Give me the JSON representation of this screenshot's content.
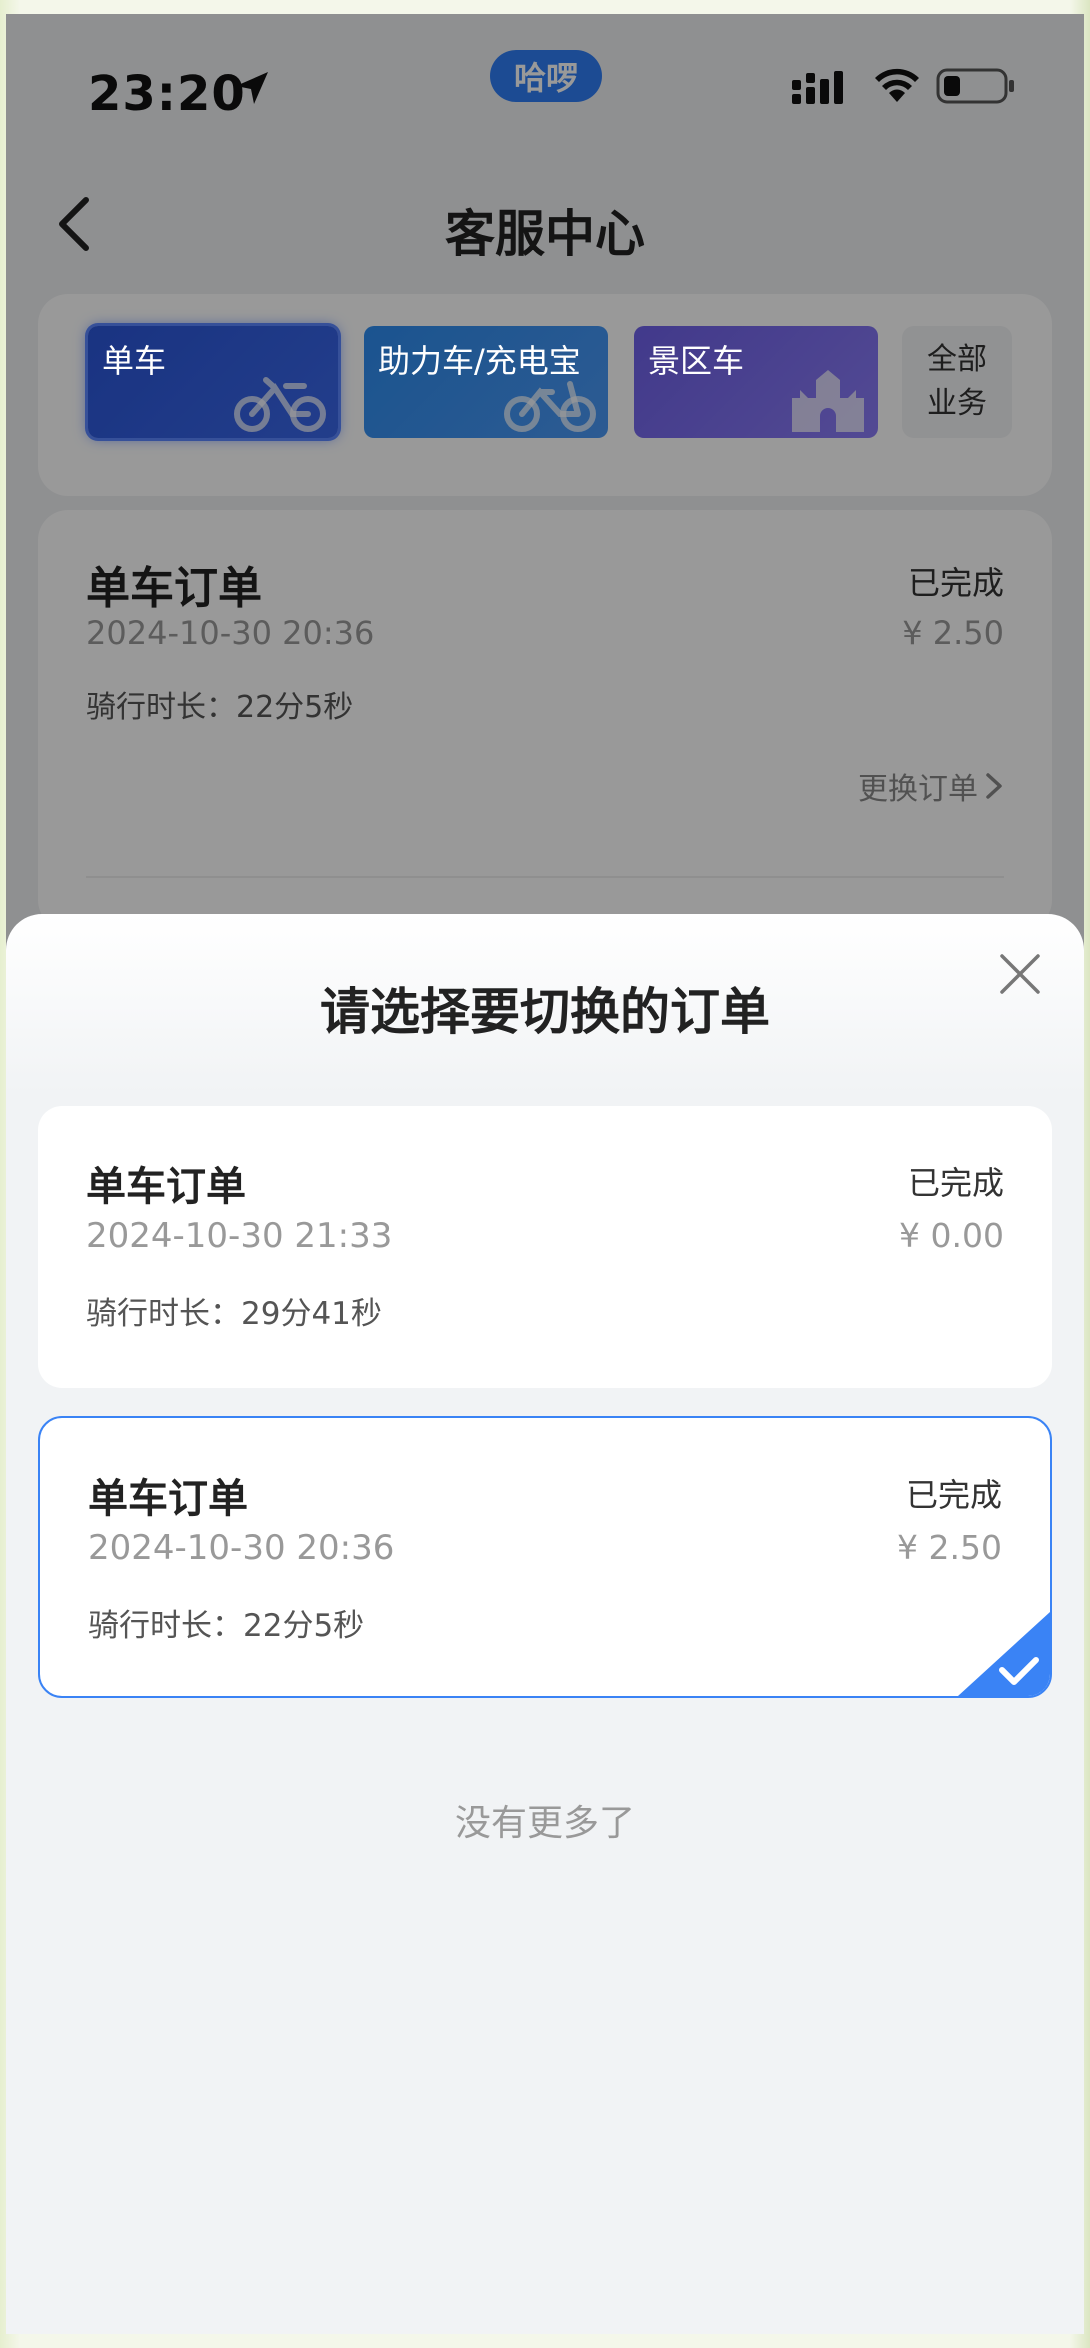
{
  "status_bar": {
    "time": "23:20",
    "app_pill": "哈啰"
  },
  "nav": {
    "title": "客服中心"
  },
  "business_tabs": [
    {
      "label": "单车",
      "icon": "bike-icon",
      "selected": true
    },
    {
      "label": "助力车/充电宝",
      "icon": "ebike-icon",
      "selected": false
    },
    {
      "label": "景区车",
      "icon": "castle-icon",
      "selected": false
    }
  ],
  "all_business": {
    "line1": "全部",
    "line2": "业务"
  },
  "current_order": {
    "title": "单车订单",
    "status": "已完成",
    "date": "2024-10-30 20:36",
    "price": "¥ 2.50",
    "duration": "骑行时长：22分5秒",
    "switch_label": "更换订单"
  },
  "sheet": {
    "title": "请选择要切换的订单",
    "orders": [
      {
        "title": "单车订单",
        "status": "已完成",
        "date": "2024-10-30 21:33",
        "price": "¥ 0.00",
        "duration": "骑行时长：29分41秒",
        "selected": false
      },
      {
        "title": "单车订单",
        "status": "已完成",
        "date": "2024-10-30 20:36",
        "price": "¥ 2.50",
        "duration": "骑行时长：22分5秒",
        "selected": true
      }
    ],
    "no_more": "没有更多了"
  },
  "colors": {
    "accent": "#3a83f5",
    "app_pill": "#2f7ef6"
  }
}
